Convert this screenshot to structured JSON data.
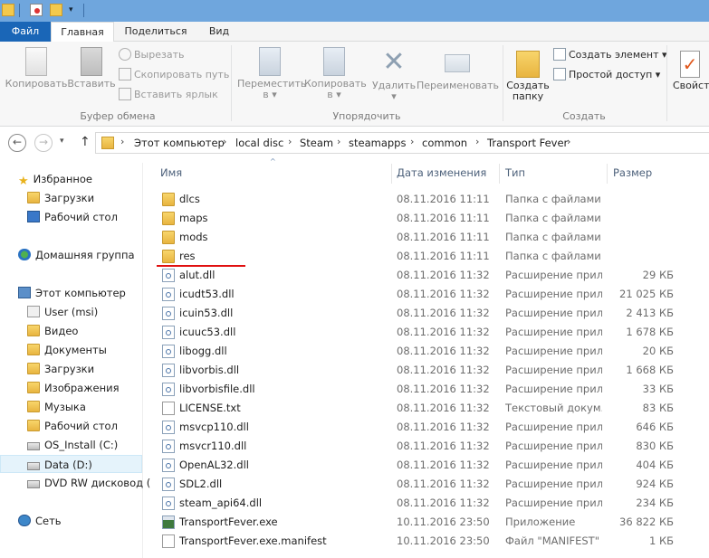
{
  "ribbon_tabs": [
    "Файл",
    "Главная",
    "Поделиться",
    "Вид"
  ],
  "ribbon": {
    "copy": "Копировать",
    "paste": "Вставить",
    "cut": "Вырезать",
    "copy_path": "Скопировать путь",
    "paste_shortcut": "Вставить ярлык",
    "clipboard_group": "Буфер обмена",
    "move_to": "Переместить",
    "move_to_arrow": "в ▾",
    "copy_to": "Копировать",
    "copy_to_arrow": "в ▾",
    "delete": "Удалить",
    "delete_arrow": "▾",
    "rename": "Переименовать",
    "organize_group": "Упорядочить",
    "new_folder_line1": "Создать",
    "new_folder_line2": "папку",
    "new_item": "Создать элемент ▾",
    "easy_access": "Простой доступ ▾",
    "create_group": "Создать",
    "properties": "Свойства"
  },
  "address": {
    "back": "←",
    "forward": "→",
    "recent": "▾",
    "up": "↑",
    "crumbs": [
      "Этот компьютер",
      "local disc",
      "Steam",
      "steamapps",
      "common",
      "Transport Fever"
    ],
    "sep": "›"
  },
  "nav": {
    "favorites": "Избранное",
    "downloads": "Загрузки",
    "desktop": "Рабочий стол",
    "homegroup": "Домашняя группа",
    "this_pc": "Этот компьютер",
    "user": "User (msi)",
    "video": "Видео",
    "documents": "Документы",
    "downloads2": "Загрузки",
    "images": "Изображения",
    "music": "Музыка",
    "desktop2": "Рабочий стол",
    "os_install": "OS_Install (C:)",
    "data_d": "Data (D:)",
    "dvd": "DVD RW дисковод (",
    "network": "Сеть"
  },
  "columns": {
    "name": "Имя",
    "date": "Дата изменения",
    "type": "Тип",
    "size": "Размер"
  },
  "files": [
    {
      "name": "dlcs",
      "date": "08.11.2016 11:11",
      "type": "Папка с файлами",
      "size": "",
      "kind": "folder"
    },
    {
      "name": "maps",
      "date": "08.11.2016 11:11",
      "type": "Папка с файлами",
      "size": "",
      "kind": "folder"
    },
    {
      "name": "mods",
      "date": "08.11.2016 11:11",
      "type": "Папка с файлами",
      "size": "",
      "kind": "folder"
    },
    {
      "name": "res",
      "date": "08.11.2016 11:11",
      "type": "Папка с файлами",
      "size": "",
      "kind": "folder"
    },
    {
      "name": "alut.dll",
      "date": "08.11.2016 11:32",
      "type": "Расширение прил...",
      "size": "29 КБ",
      "kind": "dll"
    },
    {
      "name": "icudt53.dll",
      "date": "08.11.2016 11:32",
      "type": "Расширение прил...",
      "size": "21 025 КБ",
      "kind": "dll"
    },
    {
      "name": "icuin53.dll",
      "date": "08.11.2016 11:32",
      "type": "Расширение прил...",
      "size": "2 413 КБ",
      "kind": "dll"
    },
    {
      "name": "icuuc53.dll",
      "date": "08.11.2016 11:32",
      "type": "Расширение прил...",
      "size": "1 678 КБ",
      "kind": "dll"
    },
    {
      "name": "libogg.dll",
      "date": "08.11.2016 11:32",
      "type": "Расширение прил...",
      "size": "20 КБ",
      "kind": "dll"
    },
    {
      "name": "libvorbis.dll",
      "date": "08.11.2016 11:32",
      "type": "Расширение прил...",
      "size": "1 668 КБ",
      "kind": "dll"
    },
    {
      "name": "libvorbisfile.dll",
      "date": "08.11.2016 11:32",
      "type": "Расширение прил...",
      "size": "33 КБ",
      "kind": "dll"
    },
    {
      "name": "LICENSE.txt",
      "date": "08.11.2016 11:32",
      "type": "Текстовый докум...",
      "size": "83 КБ",
      "kind": "txt"
    },
    {
      "name": "msvcp110.dll",
      "date": "08.11.2016 11:32",
      "type": "Расширение прил...",
      "size": "646 КБ",
      "kind": "dll"
    },
    {
      "name": "msvcr110.dll",
      "date": "08.11.2016 11:32",
      "type": "Расширение прил...",
      "size": "830 КБ",
      "kind": "dll"
    },
    {
      "name": "OpenAL32.dll",
      "date": "08.11.2016 11:32",
      "type": "Расширение прил...",
      "size": "404 КБ",
      "kind": "dll"
    },
    {
      "name": "SDL2.dll",
      "date": "08.11.2016 11:32",
      "type": "Расширение прил...",
      "size": "924 КБ",
      "kind": "dll"
    },
    {
      "name": "steam_api64.dll",
      "date": "08.11.2016 11:32",
      "type": "Расширение прил...",
      "size": "234 КБ",
      "kind": "dll"
    },
    {
      "name": "TransportFever.exe",
      "date": "10.11.2016 23:50",
      "type": "Приложение",
      "size": "36 822 КБ",
      "kind": "exe"
    },
    {
      "name": "TransportFever.exe.manifest",
      "date": "10.11.2016 23:50",
      "type": "Файл \"MANIFEST\"",
      "size": "1 КБ",
      "kind": "txt"
    }
  ],
  "colors": {
    "titlebar": "#6fa6dd",
    "file_tab": "#1a66b7",
    "annotation_underline": "#e01010"
  }
}
